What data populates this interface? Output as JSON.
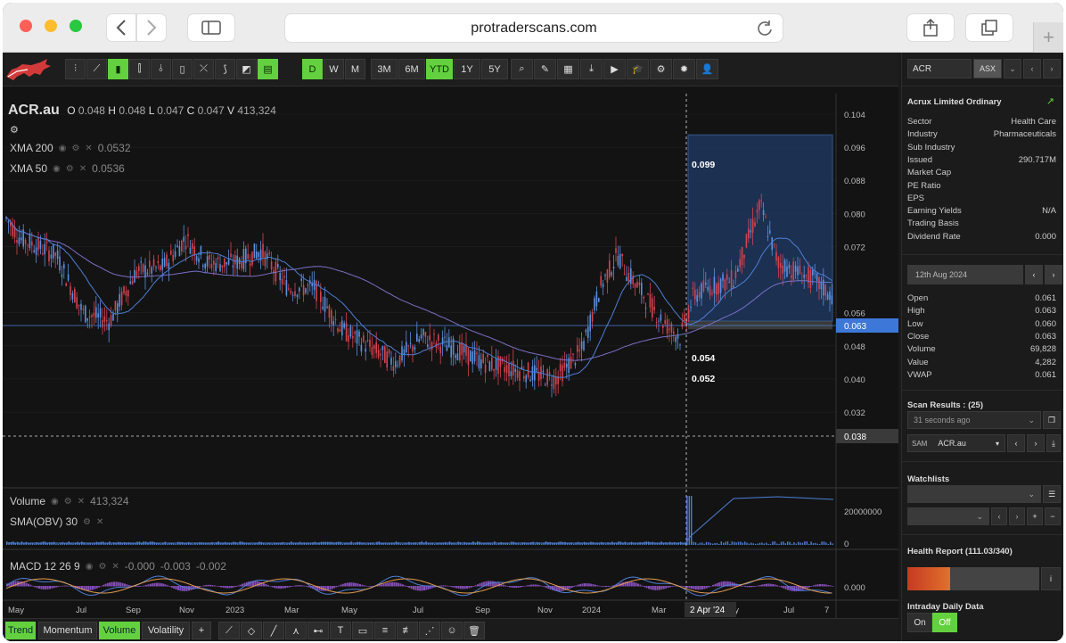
{
  "browser": {
    "url": "protraderscans.com"
  },
  "toolbar": {
    "periods": [
      "D",
      "W",
      "M"
    ],
    "ranges": [
      "3M",
      "6M",
      "YTD",
      "1Y",
      "5Y"
    ],
    "search_value": "ACR",
    "exchange": "ASX"
  },
  "chart": {
    "symbol": "ACR.au",
    "ohlc": {
      "o": "0.048",
      "h": "0.048",
      "l": "0.047",
      "c": "0.047",
      "v": "413,324"
    },
    "xma200": {
      "label": "XMA 200",
      "value": "0.0532"
    },
    "xma50": {
      "label": "XMA 50",
      "value": "0.0536"
    },
    "price_ticks": [
      "0.104",
      "0.096",
      "0.088",
      "0.080",
      "0.072",
      "0.056",
      "0.048",
      "0.040",
      "0.032"
    ],
    "last_price": "0.063",
    "crosshair_price": "0.038",
    "box_high": "0.099",
    "box_mid": "0.054",
    "box_low": "0.052",
    "volume": {
      "label": "Volume",
      "value": "413,324",
      "obv_label": "SMA(OBV) 30",
      "ticks": [
        "20000000",
        "0"
      ]
    },
    "macd": {
      "label": "MACD 12 26 9",
      "values": [
        "-0.000",
        "-0.003",
        "-0.002"
      ],
      "tick": "0.000"
    },
    "x_labels": [
      "May",
      "Jul",
      "Sep",
      "Nov",
      "2023",
      "Mar",
      "May",
      "Jul",
      "Sep",
      "Nov",
      "2024",
      "Mar",
      "May",
      "Jul",
      "7"
    ],
    "crosshair_date": "2 Apr '24",
    "colors": {
      "up": "#5b8fe0",
      "down": "#d4434f",
      "accent": "#63d13f",
      "box": "#1f3a66"
    }
  },
  "bottom_tabs": [
    "Trend",
    "Momentum",
    "Volume",
    "Volatility",
    "+"
  ],
  "sidebar": {
    "company": "Acrux Limited Ordinary",
    "info": [
      {
        "k": "Sector",
        "v": "Health Care"
      },
      {
        "k": "Industry",
        "v": "Pharmaceuticals"
      },
      {
        "k": "Sub Industry",
        "v": ""
      },
      {
        "k": "Issued",
        "v": "290.717M"
      },
      {
        "k": "Market Cap",
        "v": ""
      },
      {
        "k": "PE Ratio",
        "v": ""
      },
      {
        "k": "EPS",
        "v": ""
      },
      {
        "k": "Earning Yields",
        "v": "N/A"
      },
      {
        "k": "Trading Basis",
        "v": ""
      },
      {
        "k": "Dividend Rate",
        "v": "0.000"
      }
    ],
    "date": "12th Aug 2024",
    "daily": [
      {
        "k": "Open",
        "v": "0.061"
      },
      {
        "k": "High",
        "v": "0.063"
      },
      {
        "k": "Low",
        "v": "0.060"
      },
      {
        "k": "Close",
        "v": "0.063"
      },
      {
        "k": "Volume",
        "v": "69,828"
      },
      {
        "k": "Value",
        "v": "4,282"
      },
      {
        "k": "VWAP",
        "v": "0.061"
      }
    ],
    "scan_title": "Scan Results : (25)",
    "scan_time": "31 seconds ago",
    "scan_tag": "SAM",
    "scan_symbol": "ACR.au",
    "watchlists": "Watchlists",
    "health": "Health Report (111.03/340)",
    "intraday": "Intraday Daily Data",
    "on": "On",
    "off": "Off"
  }
}
